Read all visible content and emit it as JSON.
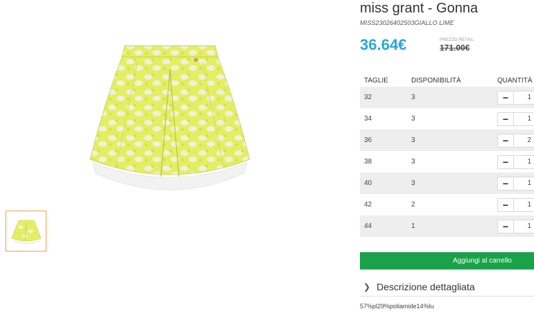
{
  "product": {
    "title": "miss grant - Gonna",
    "sku": "MISS23026402503GIALLO LIME",
    "price": "36.64€",
    "retail_label": "PREZZO RETAIL",
    "retail_price": "171.00€",
    "image_icon": "skirt-image",
    "thumbnail_icon": "skirt-thumbnail"
  },
  "table": {
    "headers": {
      "size": "TAGLIE",
      "availability": "DISPONIBILITÀ",
      "quantity": "QUANTITÀ"
    },
    "rows": [
      {
        "size": "32",
        "availability": "3",
        "quantity": "1"
      },
      {
        "size": "34",
        "availability": "3",
        "quantity": "1"
      },
      {
        "size": "36",
        "availability": "3",
        "quantity": "2"
      },
      {
        "size": "38",
        "availability": "3",
        "quantity": "1"
      },
      {
        "size": "40",
        "availability": "3",
        "quantity": "1"
      },
      {
        "size": "42",
        "availability": "2",
        "quantity": "1"
      },
      {
        "size": "44",
        "availability": "1",
        "quantity": "1"
      }
    ],
    "minus_symbol": "−"
  },
  "cart": {
    "button_label": "Aggiungi al carrello"
  },
  "description": {
    "toggle_label": "Descrizione dettagliata",
    "chevron_icon": "chevron-right-icon",
    "text": "57%pl29%poliamide14%lu"
  },
  "colors": {
    "price": "#2aa6df",
    "cart_button": "#1aa24a",
    "thumbnail_border": "#f0a04b"
  }
}
